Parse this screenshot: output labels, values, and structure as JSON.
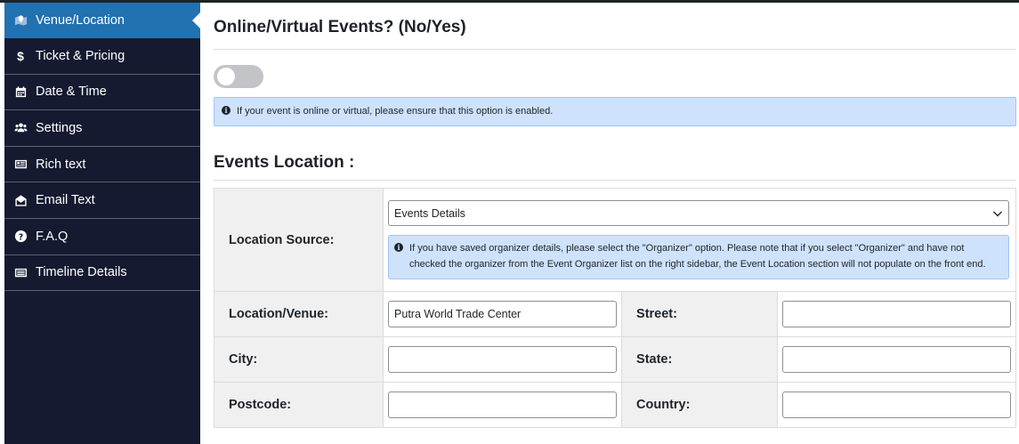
{
  "sidebar": {
    "items": [
      {
        "label": "Venue/Location",
        "icon": "map-marker-icon"
      },
      {
        "label": "Ticket & Pricing",
        "icon": "dollar-icon"
      },
      {
        "label": "Date & Time",
        "icon": "calendar-icon"
      },
      {
        "label": "Settings",
        "icon": "users-icon"
      },
      {
        "label": "Rich text",
        "icon": "rich-text-icon"
      },
      {
        "label": "Email Text",
        "icon": "envelope-icon"
      },
      {
        "label": "F.A.Q",
        "icon": "question-circle-icon"
      },
      {
        "label": "Timeline Details",
        "icon": "timeline-icon"
      }
    ]
  },
  "main": {
    "online_heading": "Online/Virtual Events? (No/Yes)",
    "online_toggle": {
      "enabled": false
    },
    "online_notice": "If your event is online or virtual, please ensure that this option is enabled.",
    "location_heading": "Events Location :",
    "location_source_label": "Location Source:",
    "location_source_value": "Events Details",
    "location_source_notice": "If you have saved organizer details, please select the \"Organizer\" option. Please note that if you select \"Organizer\" and have not checked the organizer from the Event Organizer list on the right sidebar, the Event Location section will not populate on the front end.",
    "fields": {
      "venue_label": "Location/Venue:",
      "venue_value": "Putra World Trade Center",
      "street_label": "Street:",
      "street_value": "",
      "city_label": "City:",
      "city_value": "",
      "state_label": "State:",
      "state_value": "",
      "postcode_label": "Postcode:",
      "postcode_value": "",
      "country_label": "Country:",
      "country_value": ""
    }
  },
  "colors": {
    "sidebar_bg": "#161a30",
    "active_item": "#2271b1",
    "notice_bg": "#cfe2fc"
  }
}
